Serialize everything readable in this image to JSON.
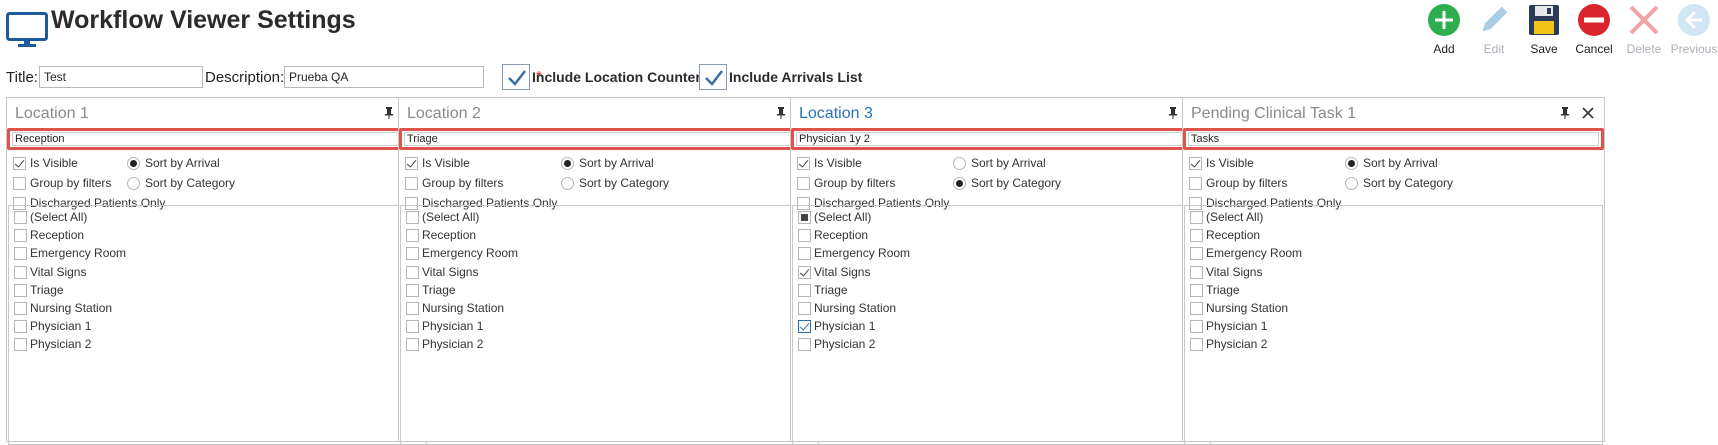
{
  "header": {
    "title": "Workflow Viewer Settings"
  },
  "toolbar": {
    "add": "Add",
    "edit": "Edit",
    "save": "Save",
    "cancel": "Cancel",
    "delete": "Delete",
    "previous": "Previous"
  },
  "form": {
    "title_label": "Title:",
    "title_value": "Test",
    "description_label": "Description:",
    "description_value": "Prueba QA",
    "required_mark": "*",
    "include_location_counters": "Include Location Counters",
    "include_arrivals_list": "Include Arrivals List"
  },
  "options": {
    "is_visible": "Is Visible",
    "group_by_filters": "Group by filters",
    "discharged_only": "Discharged Patients Only",
    "sort_by_arrival": "Sort by Arrival",
    "sort_by_category": "Sort by Category"
  },
  "list_items": [
    "(Select All)",
    "Reception",
    "Emergency Room",
    "Vital Signs",
    "Triage",
    "Nursing Station",
    "Physician 1",
    "Physician 2"
  ],
  "panels": [
    {
      "title": "Location 1",
      "name": "Reception",
      "active": false
    },
    {
      "title": "Location 2",
      "name": "Triage",
      "active": false
    },
    {
      "title": "Location 3",
      "name": "Physician 1y 2",
      "active": true
    },
    {
      "title": "Pending Clinical Task 1",
      "name": "Tasks",
      "active": false
    }
  ],
  "colors": {
    "accent": "#2a72b5",
    "highlight": "#e0534c",
    "add": "#2eae4f",
    "cancel": "#d9252b"
  }
}
